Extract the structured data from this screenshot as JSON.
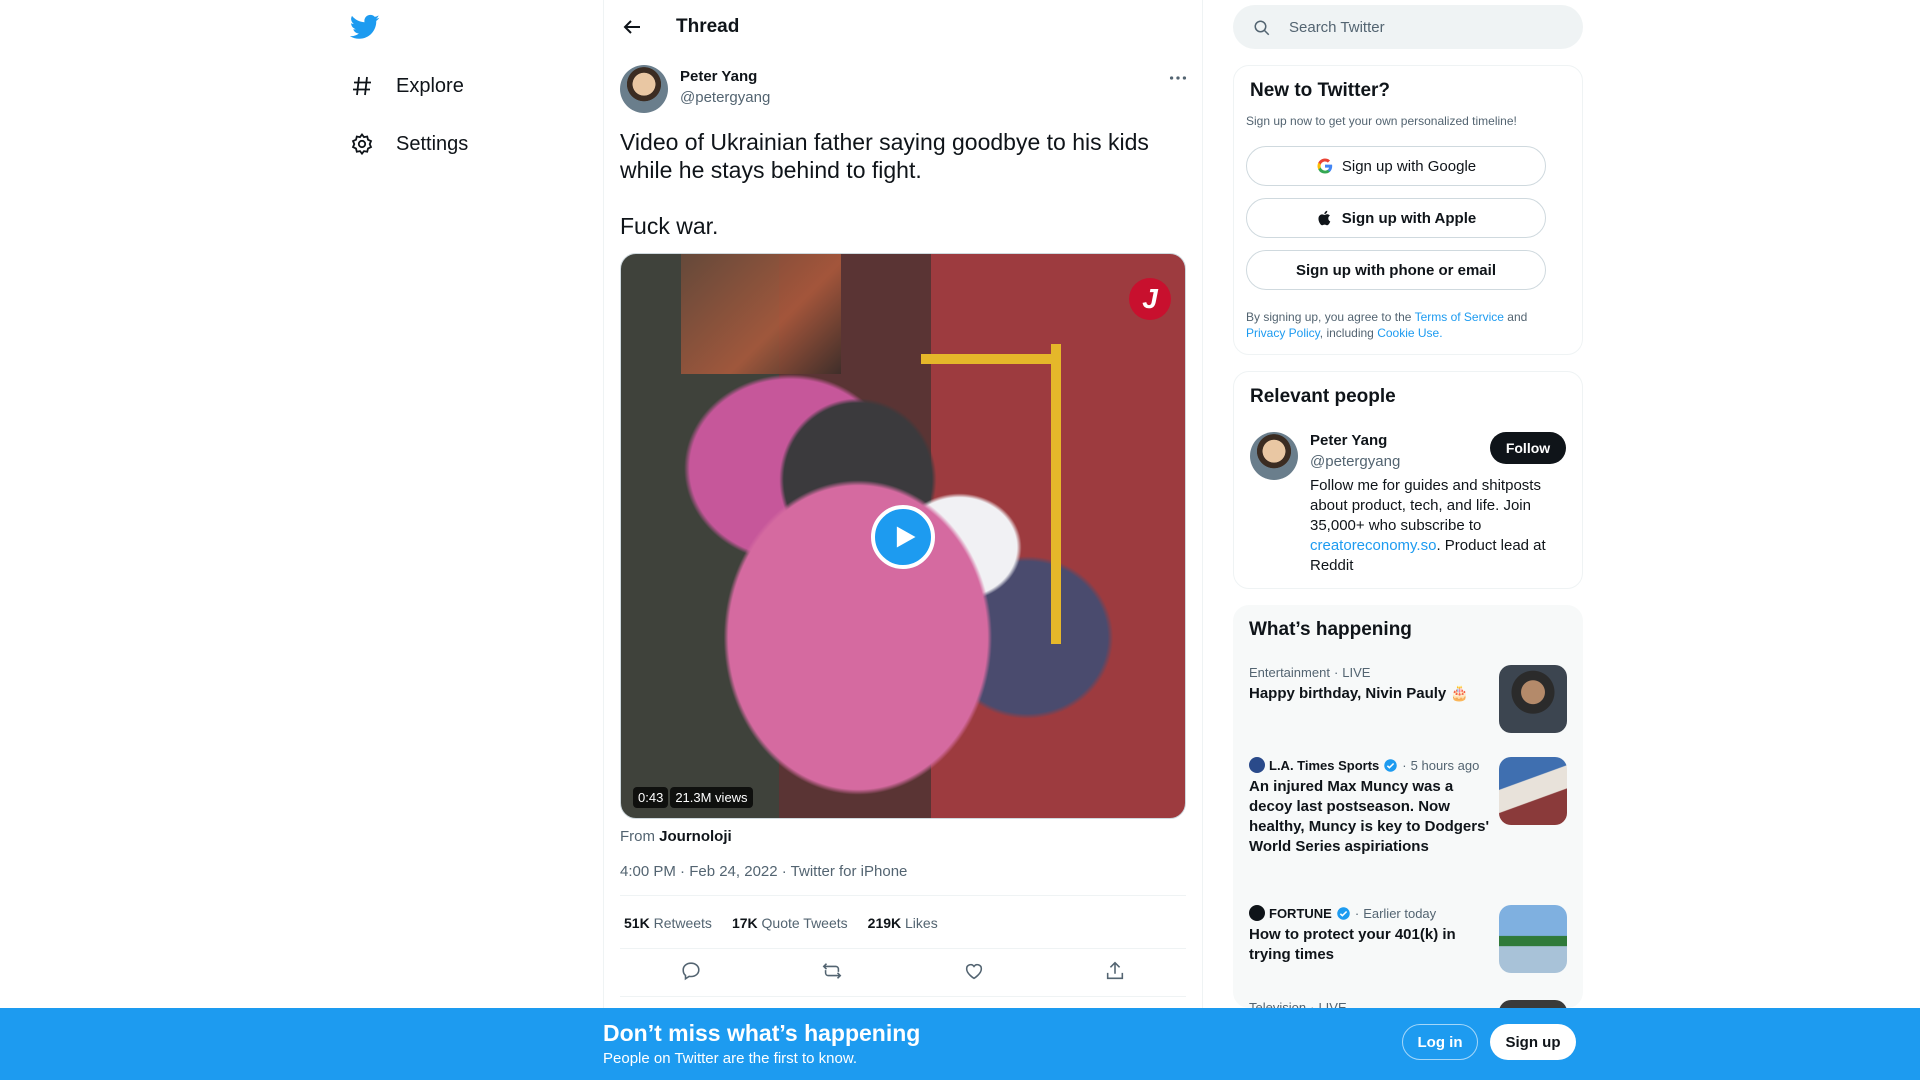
{
  "colors": {
    "brand": "#1d9bf0",
    "text": "#0f1419",
    "muted": "#536471"
  },
  "nav": {
    "logo_icon": "twitter-bird-icon",
    "items": [
      {
        "label": "Explore",
        "icon": "hashtag-icon"
      },
      {
        "label": "Settings",
        "icon": "gear-icon"
      }
    ]
  },
  "thread": {
    "title": "Thread",
    "tweet": {
      "author_name": "Peter Yang",
      "author_handle": "@petergyang",
      "text": "Video of Ukrainian father saying goodbye to his kids while he stays behind to fight.\n\nFuck war.",
      "media": {
        "duration": "0:43",
        "views": "21.3M views",
        "badge": "J"
      },
      "from_label": "From",
      "from_source": "Journoloji",
      "timestamp": "4:00 PM · Feb 24, 2022 · Twitter for iPhone",
      "stats": [
        {
          "count": "51K",
          "label": "Retweets"
        },
        {
          "count": "17K",
          "label": "Quote Tweets"
        },
        {
          "count": "219K",
          "label": "Likes"
        }
      ]
    }
  },
  "search": {
    "placeholder": "Search Twitter"
  },
  "signup_card": {
    "title": "New to Twitter?",
    "subtitle": "Sign up now to get your own personalized timeline!",
    "google": "Sign up with Google",
    "apple": "Sign up with Apple",
    "phone": "Sign up with phone or email",
    "terms_prefix": "By signing up, you agree to the",
    "terms_link": "Terms of Service",
    "terms_and": "and",
    "privacy_link": "Privacy Policy",
    "including": ", including",
    "cookie_link": "Cookie Use."
  },
  "relevant": {
    "title": "Relevant people",
    "name": "Peter Yang",
    "handle": "@petergyang",
    "follow": "Follow",
    "bio_1": "Follow me for guides and shitposts about product, tech, and life. Join 35,000+ who subscribe to ",
    "bio_link": "creatoreconomy.so",
    "bio_2": ". Product lead at Reddit"
  },
  "happening": {
    "title": "What’s happening",
    "trends": [
      {
        "category": "Entertainment",
        "sep": "·",
        "status": "LIVE",
        "title": "Happy birthday, Nivin Pauly 🎂"
      },
      {
        "source": "L.A. Times Sports",
        "sep": "·",
        "time": "5 hours ago",
        "title": "An injured Max Muncy was a decoy last postseason. Now healthy, Muncy is key to Dodgers' World Series aspiriations"
      },
      {
        "source": "FORTUNE",
        "sep": "·",
        "time": "Earlier today",
        "title": "How to protect your 401(k) in trying times"
      },
      {
        "category": "Television",
        "sep": "·",
        "status": "LIVE"
      }
    ]
  },
  "bottom_bar": {
    "title": "Don’t miss what’s happening",
    "subtitle": "People on Twitter are the first to know.",
    "login": "Log in",
    "signup": "Sign up"
  }
}
